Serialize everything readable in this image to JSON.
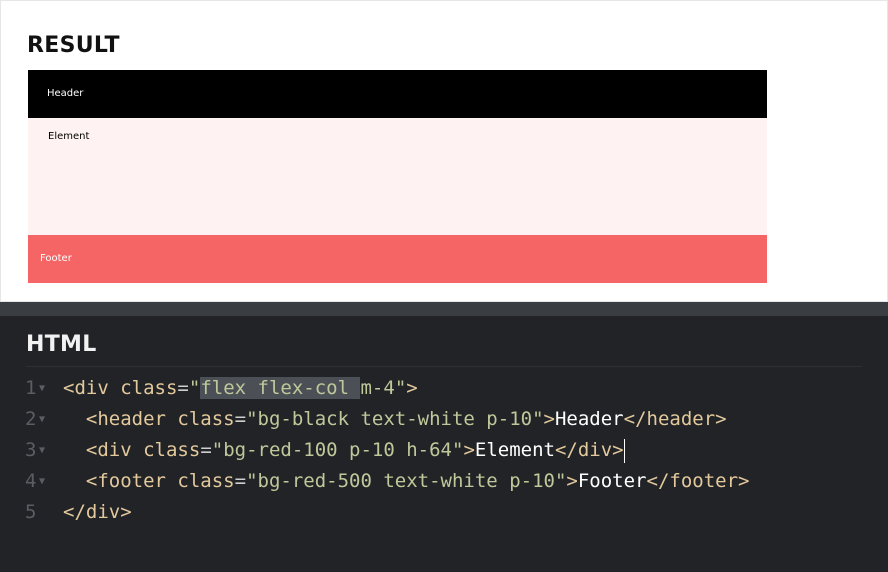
{
  "result": {
    "title": "RESULT",
    "header_text": "Header",
    "element_text": "Element",
    "footer_text": "Footer"
  },
  "html_panel": {
    "title": "HTML",
    "lines": [
      {
        "num": "1",
        "indent": "",
        "open": "<div",
        "attr": "class",
        "eq": "=",
        "q1": "\"",
        "selected": "flex flex-col ",
        "rest": "m-4",
        "q2": "\"",
        "close": ">",
        "text": "",
        "end": ""
      },
      {
        "num": "2",
        "indent": "  ",
        "open": "<header",
        "attr": "class",
        "eq": "=",
        "q1": "\"",
        "selected": "",
        "rest": "bg-black text-white p-10",
        "q2": "\"",
        "close": ">",
        "text": "Header",
        "end": "</header>"
      },
      {
        "num": "3",
        "indent": "  ",
        "open": "<div",
        "attr": "class",
        "eq": "=",
        "q1": "\"",
        "selected": "",
        "rest": "bg-red-100 p-10 h-64",
        "q2": "\"",
        "close": ">",
        "text": "Element",
        "end": "</div>"
      },
      {
        "num": "4",
        "indent": "  ",
        "open": "<footer",
        "attr": "class",
        "eq": "=",
        "q1": "\"",
        "selected": "",
        "rest": "bg-red-500 text-white p-10",
        "q2": "\"",
        "close": ">",
        "text": "Footer",
        "end": "</footer>"
      },
      {
        "num": "5",
        "indent": "",
        "open": "</div>",
        "attr": "",
        "eq": "",
        "q1": "",
        "selected": "",
        "rest": "",
        "q2": "",
        "close": "",
        "text": "",
        "end": ""
      }
    ]
  },
  "colors": {
    "header_bg": "#000000",
    "element_bg": "#fef3f2",
    "footer_bg": "#f56565",
    "editor_bg": "#212327"
  },
  "icons": {
    "fold": "chevron-down-icon"
  }
}
